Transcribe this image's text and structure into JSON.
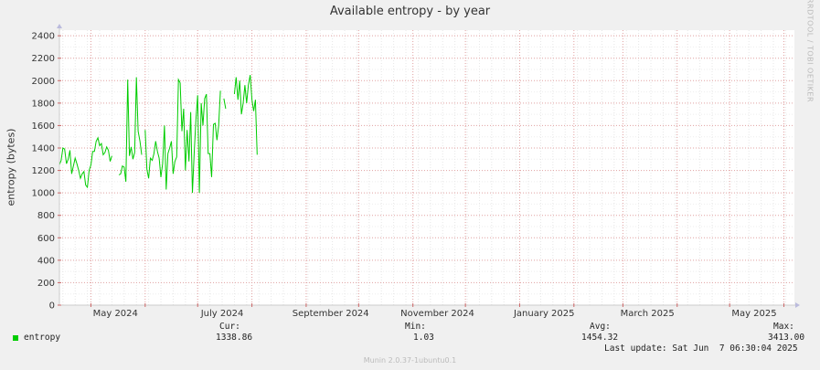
{
  "title": "Available entropy - by year",
  "ylabel": "entropy (bytes)",
  "watermark": "RRDTOOL / TOBI OETIKER",
  "legend": {
    "series_name": "entropy",
    "cur_label": "Cur:",
    "cur_value": "1338.86",
    "min_label": "Min:",
    "min_value": "1.03",
    "avg_label": "Avg:",
    "avg_value": "1454.32",
    "max_label": "Max:",
    "max_value": "3413.00",
    "last_update": "Last update: Sat Jun  7 06:30:04 2025"
  },
  "footer": "Munin 2.0.37-1ubuntu0.1",
  "colors": {
    "series": "#00cc00",
    "background": "#f0f0f0",
    "plot": "#ffffff"
  },
  "chart_data": {
    "type": "line",
    "title": "Available entropy - by year",
    "ylabel": "entropy (bytes)",
    "ylim": [
      0,
      2450
    ],
    "yticks": [
      0,
      200,
      400,
      600,
      800,
      1000,
      1200,
      1400,
      1600,
      1800,
      2000,
      2200,
      2400
    ],
    "x_month_labels": [
      "May 2024",
      "July 2024",
      "September 2024",
      "November 2024",
      "January 2025",
      "March 2025",
      "May 2025"
    ],
    "x_month_ticks": [
      "2024-05-01",
      "2024-06-01",
      "2024-07-01",
      "2024-08-01",
      "2024-09-01",
      "2024-10-01",
      "2024-11-01",
      "2024-12-01",
      "2025-01-01",
      "2025-02-01",
      "2025-03-01",
      "2025-04-01",
      "2025-05-01",
      "2025-06-01"
    ],
    "x_label_dates": [
      "2024-05-15",
      "2024-07-15",
      "2024-09-15",
      "2024-11-15",
      "2025-01-15",
      "2025-03-15",
      "2025-05-15"
    ],
    "x_range": [
      "2024-04-13",
      "2025-06-07"
    ],
    "grid": true,
    "legend_position": "bottom",
    "series": [
      {
        "name": "entropy",
        "color": "#00cc00",
        "segments": [
          [
            [
              "2024-04-13",
              1250
            ],
            [
              "2024-04-14",
              1290
            ],
            [
              "2024-04-15",
              1400
            ],
            [
              "2024-04-16",
              1390
            ],
            [
              "2024-04-17",
              1260
            ],
            [
              "2024-04-18",
              1300
            ],
            [
              "2024-04-19",
              1380
            ],
            [
              "2024-04-20",
              1170
            ],
            [
              "2024-04-21",
              1240
            ],
            [
              "2024-04-22",
              1310
            ],
            [
              "2024-04-23",
              1260
            ],
            [
              "2024-04-24",
              1200
            ],
            [
              "2024-04-25",
              1130
            ],
            [
              "2024-04-26",
              1170
            ],
            [
              "2024-04-27",
              1190
            ],
            [
              "2024-04-28",
              1070
            ],
            [
              "2024-04-29",
              1050
            ],
            [
              "2024-04-30",
              1200
            ],
            [
              "2024-05-01",
              1250
            ],
            [
              "2024-05-02",
              1370
            ],
            [
              "2024-05-03",
              1370
            ],
            [
              "2024-05-04",
              1460
            ],
            [
              "2024-05-05",
              1490
            ],
            [
              "2024-05-06",
              1420
            ],
            [
              "2024-05-07",
              1440
            ],
            [
              "2024-05-08",
              1340
            ],
            [
              "2024-05-09",
              1360
            ],
            [
              "2024-05-10",
              1410
            ],
            [
              "2024-05-11",
              1380
            ],
            [
              "2024-05-12",
              1280
            ],
            [
              "2024-05-13",
              1330
            ]
          ],
          [
            [
              "2024-05-17",
              1160
            ],
            [
              "2024-05-18",
              1170
            ],
            [
              "2024-05-19",
              1240
            ],
            [
              "2024-05-20",
              1230
            ],
            [
              "2024-05-21",
              1100
            ],
            [
              "2024-05-22",
              2010
            ],
            [
              "2024-05-23",
              1330
            ],
            [
              "2024-05-24",
              1410
            ],
            [
              "2024-05-25",
              1300
            ],
            [
              "2024-05-26",
              1360
            ],
            [
              "2024-05-27",
              2030
            ],
            [
              "2024-05-28",
              1550
            ],
            [
              "2024-05-29",
              1460
            ],
            [
              "2024-05-30",
              1340
            ]
          ],
          [
            [
              "2024-06-01",
              1560
            ],
            [
              "2024-06-02",
              1210
            ],
            [
              "2024-06-03",
              1130
            ],
            [
              "2024-06-04",
              1310
            ],
            [
              "2024-06-05",
              1290
            ],
            [
              "2024-06-06",
              1350
            ],
            [
              "2024-06-07",
              1460
            ],
            [
              "2024-06-08",
              1370
            ],
            [
              "2024-06-09",
              1310
            ],
            [
              "2024-06-10",
              1140
            ],
            [
              "2024-06-11",
              1260
            ],
            [
              "2024-06-12",
              1600
            ],
            [
              "2024-06-13",
              1030
            ],
            [
              "2024-06-14",
              1350
            ],
            [
              "2024-06-15",
              1400
            ],
            [
              "2024-06-16",
              1460
            ],
            [
              "2024-06-17",
              1170
            ],
            [
              "2024-06-18",
              1280
            ],
            [
              "2024-06-19",
              1320
            ],
            [
              "2024-06-20",
              2010
            ],
            [
              "2024-06-21",
              1980
            ],
            [
              "2024-06-22",
              1550
            ],
            [
              "2024-06-23",
              1750
            ],
            [
              "2024-06-24",
              1200
            ],
            [
              "2024-06-25",
              1560
            ],
            [
              "2024-06-26",
              1280
            ],
            [
              "2024-06-27",
              1720
            ],
            [
              "2024-06-28",
              1000
            ],
            [
              "2024-06-29",
              1350
            ],
            [
              "2024-06-30",
              1650
            ],
            [
              "2024-07-01",
              1870
            ],
            [
              "2024-07-02",
              1000
            ],
            [
              "2024-07-03",
              1800
            ],
            [
              "2024-07-04",
              1600
            ],
            [
              "2024-07-05",
              1840
            ],
            [
              "2024-07-06",
              1880
            ],
            [
              "2024-07-07",
              1350
            ],
            [
              "2024-07-08",
              1350
            ],
            [
              "2024-07-09",
              1140
            ],
            [
              "2024-07-10",
              1610
            ],
            [
              "2024-07-11",
              1620
            ],
            [
              "2024-07-12",
              1470
            ],
            [
              "2024-07-13",
              1600
            ],
            [
              "2024-07-14",
              1910
            ]
          ],
          [
            [
              "2024-07-16",
              1840
            ],
            [
              "2024-07-17",
              1750
            ]
          ],
          [
            [
              "2024-07-22",
              1880
            ],
            [
              "2024-07-23",
              2030
            ],
            [
              "2024-07-24",
              1830
            ],
            [
              "2024-07-25",
              2000
            ],
            [
              "2024-07-26",
              1700
            ],
            [
              "2024-07-27",
              1800
            ],
            [
              "2024-07-28",
              1960
            ],
            [
              "2024-07-29",
              1800
            ],
            [
              "2024-07-30",
              1960
            ],
            [
              "2024-07-31",
              2050
            ],
            [
              "2024-08-01",
              1830
            ],
            [
              "2024-08-02",
              1730
            ],
            [
              "2024-08-03",
              1830
            ],
            [
              "2024-08-04",
              1340
            ]
          ]
        ]
      }
    ]
  }
}
